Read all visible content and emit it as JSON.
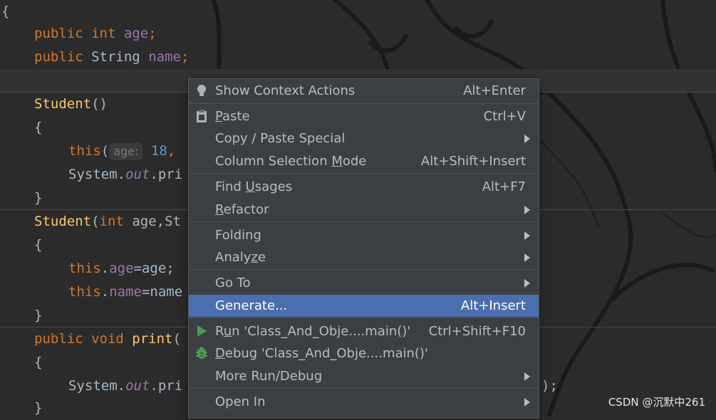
{
  "editor": {
    "lines": {
      "l1": "{",
      "l2_kw": "public int",
      "l2_fld": "age",
      "l2_end": ";",
      "l3_kw": "public",
      "l3_type": "String",
      "l3_fld": "name",
      "l3_end": ";",
      "l5_fn": "Student",
      "l5_rest": "()",
      "l6": "{",
      "l7_kw": "this",
      "l7_paren": "(",
      "l7_hint": "age:",
      "l7_num": "18",
      "l7_comma": ",",
      "l8_a": "System.",
      "l8_b": "out",
      "l8_c": ".pri",
      "l9": "}",
      "l10_fn": "Student",
      "l10_paren": "(",
      "l10_kw": "int",
      "l10_b": "age",
      "l10_c": ",St",
      "l11": "{",
      "l12_kw": "this",
      "l12_dot": ".",
      "l12_fld": "age",
      "l12_rest": "=age;",
      "l13_kw": "this",
      "l13_dot": ".",
      "l13_fld": "name",
      "l13_rest": "=name",
      "l14": "}",
      "l15_kw": "public void",
      "l15_fn": "print",
      "l15_rest": "(",
      "l16": "{",
      "l17_a": "System.",
      "l17_b": "out",
      "l17_c": ".pri",
      "l17_end": ");",
      "l18": "}"
    }
  },
  "context_menu": {
    "show_context_actions": {
      "label": "Show Context Actions",
      "shortcut": "Alt+Enter",
      "icon": "lightbulb-icon"
    },
    "paste": {
      "label_u": "P",
      "label_rest": "aste",
      "shortcut": "Ctrl+V",
      "icon": "clipboard-icon"
    },
    "copy_paste_special": {
      "label": "Copy / Paste Special"
    },
    "column_selection_mode": {
      "label_a": "Column Selection ",
      "label_u": "M",
      "label_b": "ode",
      "shortcut": "Alt+Shift+Insert"
    },
    "find_usages": {
      "label_a": "Find ",
      "label_u": "U",
      "label_b": "sages",
      "shortcut": "Alt+F7"
    },
    "refactor": {
      "label_u": "R",
      "label_rest": "efactor"
    },
    "folding": {
      "label": "Folding"
    },
    "analyze": {
      "label_a": "Analy",
      "label_u": "z",
      "label_b": "e"
    },
    "go_to": {
      "label": "Go To"
    },
    "generate": {
      "label": "Generate...",
      "shortcut": "Alt+Insert"
    },
    "run": {
      "label_a": "R",
      "label_u": "u",
      "label_b": "n 'Class_And_Obje....main()'",
      "shortcut": "Ctrl+Shift+F10",
      "icon": "run-triangle-icon"
    },
    "debug": {
      "label_u": "D",
      "label_rest": "ebug 'Class_And_Obje....main()'",
      "icon": "debug-bug-icon"
    },
    "more_run_debug": {
      "label": "More Run/Debug"
    },
    "open_in": {
      "label": "Open In"
    }
  },
  "watermark": "CSDN @沉默中261",
  "colors": {
    "selected": "#4b6eaf",
    "menu_bg": "#3c3f41",
    "editor_bg": "#2b2b2b",
    "keyword": "#cc7832",
    "field": "#9876aa",
    "function": "#ffc66d"
  }
}
